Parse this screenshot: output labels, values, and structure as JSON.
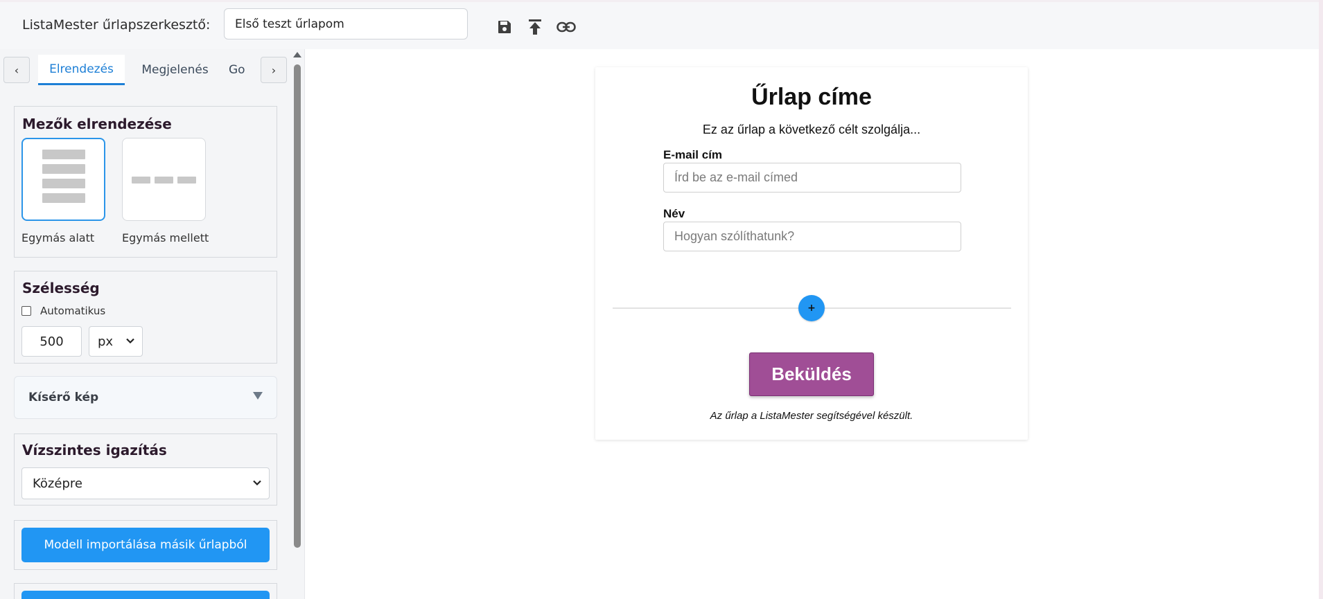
{
  "header": {
    "app_title": "ListaMester űrlapszerkesztő:",
    "form_name": "Első teszt űrlapom",
    "icons": [
      "save-icon",
      "upload-icon",
      "link-icon"
    ]
  },
  "sidebar": {
    "tab_prev": "‹",
    "tab_next": "›",
    "tabs": [
      {
        "label": "Elrendezés",
        "active": true
      },
      {
        "label": "Megjelenés",
        "active": false
      },
      {
        "label": "Go",
        "active": false
      }
    ],
    "field_layout": {
      "title": "Mezők elrendezése",
      "options": [
        {
          "label": "Egymás alatt",
          "selected": true
        },
        {
          "label": "Egymás mellett",
          "selected": false
        }
      ]
    },
    "width": {
      "title": "Szélesség",
      "auto_label": "Automatikus",
      "auto_checked": false,
      "value": "500",
      "unit": "px"
    },
    "accompanying_image": {
      "label": "Kísérő kép"
    },
    "horizontal_alignment": {
      "title": "Vízszintes igazítás",
      "value": "Középre"
    },
    "import_button": "Modell importálása másik űrlapból"
  },
  "form": {
    "title": "Űrlap címe",
    "description": "Ez az űrlap a következő célt szolgálja...",
    "fields": [
      {
        "label": "E-mail cím",
        "placeholder": "Írd be az e-mail címed"
      },
      {
        "label": "Név",
        "placeholder": "Hogyan szólíthatunk?"
      }
    ],
    "add_symbol": "+",
    "submit_label": "Beküldés",
    "credit": "Az űrlap a ListaMester segítségével készült."
  },
  "colors": {
    "accent": "#2196f3",
    "active_tab": "#1d7fd6",
    "submit": "#a04e96"
  }
}
